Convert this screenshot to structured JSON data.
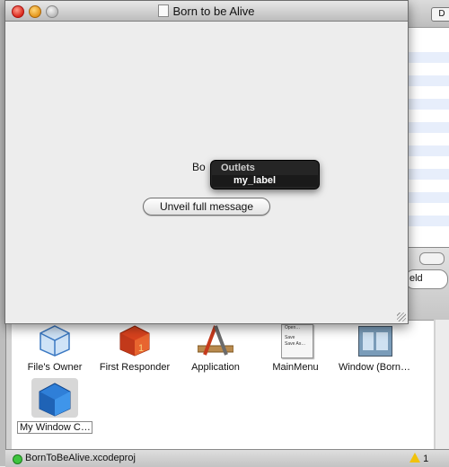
{
  "main_window": {
    "title": "Born to be Alive",
    "partial_label": "Bo",
    "unveil_button": "Unveil full message"
  },
  "outlets_popup": {
    "title": "Outlets",
    "items": [
      "my_label"
    ]
  },
  "ib_document": {
    "search_partial": "eld",
    "objects": [
      {
        "label": "File's Owner",
        "icon": "cube-blue-outline-icon"
      },
      {
        "label": "First Responder",
        "icon": "cube-red-icon"
      },
      {
        "label": "Application",
        "icon": "app-icon"
      },
      {
        "label": "MainMenu",
        "icon": "menu-icon"
      },
      {
        "label": "Window (Born…",
        "icon": "window-icon"
      },
      {
        "label": "My Window C…",
        "icon": "cube-blue-icon"
      }
    ],
    "menu_icon_lines": [
      "Open…",
      "Save",
      "Save As…"
    ]
  },
  "status_bar": {
    "project": "BornToBeAlive.xcodeproj",
    "warning_count": "1"
  },
  "background_editor": {
    "pill_label": "D"
  },
  "colors": {
    "hud_bg": "#141414",
    "status_ok": "#3ec43e",
    "warning": "#f1c20c"
  }
}
